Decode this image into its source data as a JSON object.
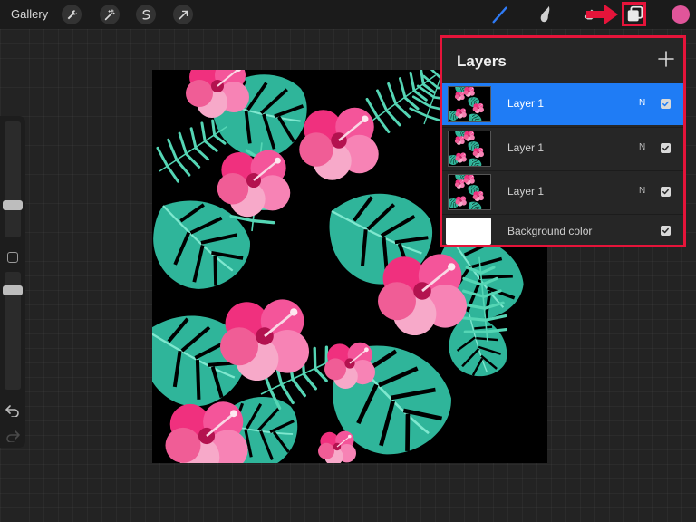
{
  "toolbar": {
    "gallery_label": "Gallery",
    "left_tools": [
      {
        "name": "actions-wrench-icon"
      },
      {
        "name": "adjustments-wand-icon"
      },
      {
        "name": "selection-icon"
      },
      {
        "name": "transform-arrow-icon"
      }
    ],
    "right_tools": [
      {
        "name": "brush-icon",
        "color": "#2f7bf6"
      },
      {
        "name": "smudge-icon",
        "color": "#cfcfcf"
      },
      {
        "name": "eraser-icon",
        "color": "#cfcfcf"
      },
      {
        "name": "layers-icon",
        "color": "#e8e8e8"
      }
    ],
    "current_color": "#e0559a",
    "highlight_color": "#e5143a"
  },
  "sidebar": {
    "brush_size_thumb": "slider-thumb",
    "opacity_thumb": "slider-thumb",
    "undo_icon": "undo-icon",
    "redo_icon": "redo-icon"
  },
  "canvas": {
    "artwork": "tropical-floral-pattern"
  },
  "layers_panel": {
    "title": "Layers",
    "add_icon": "plus-icon",
    "layers": [
      {
        "name": "Layer 1",
        "blend_mode": "N",
        "visible": true,
        "selected": true
      },
      {
        "name": "Layer 1",
        "blend_mode": "N",
        "visible": true,
        "selected": false
      },
      {
        "name": "Layer 1",
        "blend_mode": "N",
        "visible": true,
        "selected": false
      }
    ],
    "background": {
      "name": "Background color",
      "visible": true,
      "color": "#ffffff"
    }
  },
  "colors": {
    "accent": "#1f7cf5",
    "leaf": "#2fb59a",
    "leaf_light": "#6fe0c4",
    "flower_hot": "#f0307e",
    "flower_light": "#f7a9c9"
  }
}
